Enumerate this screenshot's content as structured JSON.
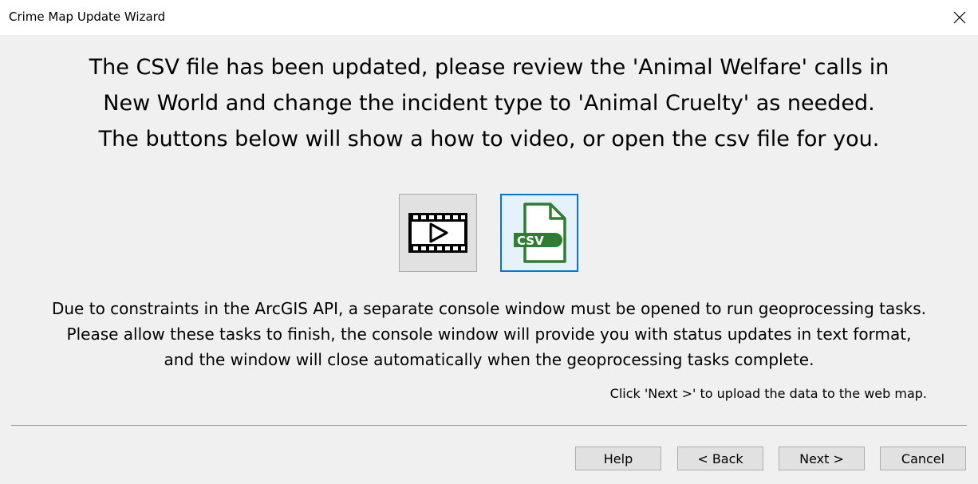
{
  "window": {
    "title": "Crime Map Update Wizard",
    "close_icon": "close-icon"
  },
  "main_message": {
    "lines": [
      "The CSV file has been updated, please review the 'Animal Welfare' calls in",
      "New World and change the incident type to 'Animal Cruelty' as needed.",
      "The buttons below will show a how to video, or open the csv file for you."
    ]
  },
  "action_buttons": {
    "video": {
      "icon": "video-icon"
    },
    "csv": {
      "icon": "csv-file-icon",
      "badge_text": "CSV",
      "accent_color": "#2e7d32"
    }
  },
  "info": {
    "lines": [
      "Due to constraints in the ArcGIS API, a separate console window must be opened to run geoprocessing tasks.",
      "Please allow these tasks to finish, the console window will provide you with status updates in text format,",
      "and the window will close automatically when the geoprocessing tasks complete."
    ],
    "next_hint": "Click 'Next >' to upload the data to the web map."
  },
  "footer": {
    "help_label": "Help",
    "back_label": "< Back",
    "next_label": "Next >",
    "cancel_label": "Cancel"
  },
  "colors": {
    "focus_border": "#0078d7",
    "button_face": "#e1e1e1",
    "dialog_background": "#f0f0f0"
  }
}
